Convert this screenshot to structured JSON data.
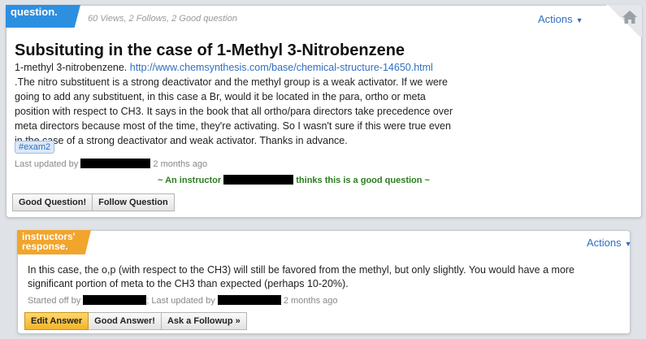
{
  "question": {
    "tag_label": "question.",
    "stats": "60 Views, 2 Follows, 2 Good question",
    "actions_label": "Actions",
    "title": "Subsituting in the case of 1-Methyl 3-Nitrobenzene",
    "body_before_link": "1-methyl 3-nitrobenzene. ",
    "link_text": "http://www.chemsynthesis.com/base/chemical-structure-14650.html",
    "body_after_link": " .The nitro substituent is a strong deactivator and the methyl group is a weak activator. If we were going to add any substituent, in this case a Br, would it be located in the para, ortho or meta position with respect to CH3. It says in the book that all ortho/para directors take precedence over meta directors because most of the time, they're activating. So I wasn't sure if this were true even in the case of a strong deactivator and weak activator. Thanks in advance.",
    "tag_chip": "#exam2",
    "last_updated_label": "Last updated by",
    "last_updated_time": "2 months ago",
    "instructor_note_prefix": "~ An instructor",
    "instructor_note_suffix": "thinks this is a good question ~",
    "buttons": {
      "good_question": "Good Question!",
      "follow_question": "Follow Question"
    }
  },
  "response": {
    "tag_line1": "instructors'",
    "tag_line2": "response.",
    "actions_label": "Actions",
    "body": "In this case, the o,p (with respect to the CH3) will still be favored from the methyl, but only slightly. You would have a more significant portion of meta to the CH3 than expected (perhaps 10-20%).",
    "started_off_label": "Started off by",
    "last_updated_label": "; Last updated by",
    "last_updated_time": "2 months ago",
    "buttons": {
      "edit_answer": "Edit Answer",
      "good_answer": "Good Answer!",
      "ask_followup": "Ask a Followup »"
    }
  },
  "colors": {
    "question_tag": "#2d8fe0",
    "response_tag": "#f2a52c",
    "link": "#2f6fc0",
    "instructor_note": "#2a7d1e"
  },
  "icons": [
    "home-icon",
    "caret-down-icon"
  ]
}
